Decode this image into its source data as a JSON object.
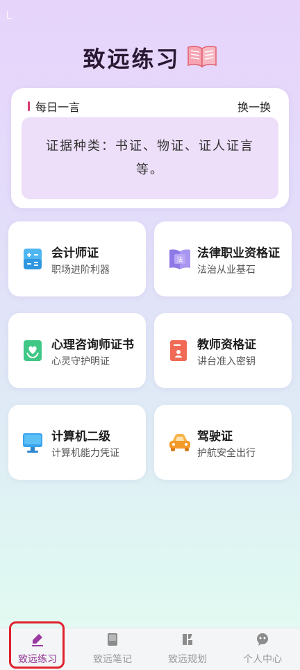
{
  "header": {
    "title": "致远练习",
    "icon": "open-book-icon"
  },
  "quote": {
    "label": "每日一言",
    "refresh_label": "换一换",
    "text": "证据种类：书证、物证、证人证言等。"
  },
  "certificates": [
    {
      "title": "会计师证",
      "subtitle": "职场进阶利器",
      "icon": "calculator-icon"
    },
    {
      "title": "法律职业资格证",
      "subtitle": "法治从业基石",
      "icon": "law-book-icon"
    },
    {
      "title": "心理咨询师证书",
      "subtitle": "心灵守护明证",
      "icon": "heart-hands-icon"
    },
    {
      "title": "教师资格证",
      "subtitle": "讲台准入密钥",
      "icon": "teacher-certificate-icon"
    },
    {
      "title": "计算机二级",
      "subtitle": "计算机能力凭证",
      "icon": "computer-monitor-icon"
    },
    {
      "title": "驾驶证",
      "subtitle": "护航安全出行",
      "icon": "car-icon"
    }
  ],
  "tabs": [
    {
      "label": "致远练习",
      "icon": "pen-icon",
      "active": true
    },
    {
      "label": "致远笔记",
      "icon": "notebook-icon",
      "active": false
    },
    {
      "label": "致远规划",
      "icon": "plan-blocks-icon",
      "active": false
    },
    {
      "label": "个人中心",
      "icon": "person-chat-icon",
      "active": false
    }
  ],
  "colors": {
    "accent": "#8f2f92",
    "highlight": "#e0202c",
    "quote_bar": "#d63b6b"
  }
}
